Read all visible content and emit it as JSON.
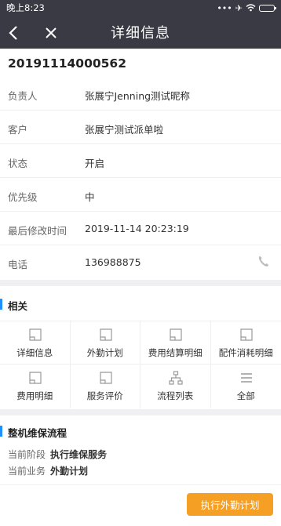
{
  "status_bar": {
    "time": "晚上8:23"
  },
  "header": {
    "title": "详细信息"
  },
  "order": {
    "id": "20191114000562"
  },
  "details": [
    {
      "label": "负责人",
      "value": "张展宁Jenning测试昵称"
    },
    {
      "label": "客户",
      "value": "张展宁测试派单啦"
    },
    {
      "label": "状态",
      "value": "开启"
    },
    {
      "label": "优先级",
      "value": "中"
    },
    {
      "label": "最后修改时间",
      "value": "2019-11-14 20:23:19"
    },
    {
      "label": "电话",
      "value": "136988875"
    }
  ],
  "related": {
    "title": "相关",
    "items": [
      {
        "label": "详细信息",
        "icon": "doc-icon"
      },
      {
        "label": "外勤计划",
        "icon": "doc-icon"
      },
      {
        "label": "费用结算明细",
        "icon": "doc-icon"
      },
      {
        "label": "配件消耗明细",
        "icon": "doc-icon"
      },
      {
        "label": "费用明细",
        "icon": "doc-icon"
      },
      {
        "label": "服务评价",
        "icon": "doc-icon"
      },
      {
        "label": "流程列表",
        "icon": "tree-icon"
      },
      {
        "label": "全部",
        "icon": "menu-icon"
      }
    ]
  },
  "flow": {
    "title": "整机维保流程",
    "stage_label": "当前阶段",
    "stage_value": "执行维保服务",
    "business_label": "当前业务",
    "business_value": "外勤计划",
    "action_label": "执行外勤计划"
  },
  "colors": {
    "header_bg": "#393a44",
    "accent": "#1e90ff",
    "action": "#f5a024"
  }
}
